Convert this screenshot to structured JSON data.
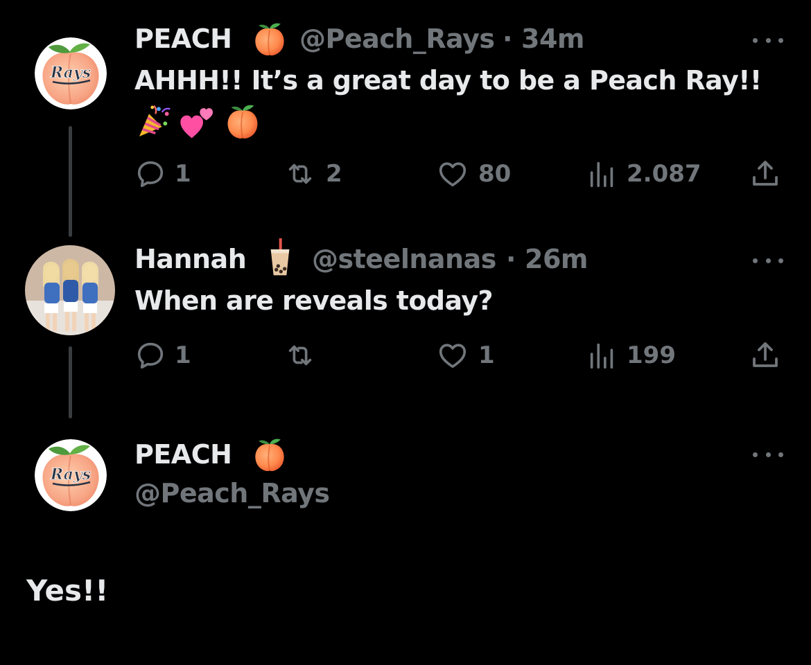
{
  "colors": {
    "background": "#000000",
    "text": "#e7e9ea",
    "muted": "#71767b",
    "thread_line": "#3a3d40"
  },
  "tweet1": {
    "name": "PEACH",
    "name_emoji": "peach-emoji",
    "handle": "@Peach_Rays",
    "separator": "·",
    "time": "34m",
    "text": "AHHH!! It’s a great day to be a Peach Ray!!",
    "text_emojis": [
      "party-popper-emoji",
      "two-hearts-emoji",
      "peach-emoji"
    ],
    "avatar_text": "Rays",
    "replies": "1",
    "retweets": "2",
    "likes": "80",
    "views": "2.087"
  },
  "tweet2": {
    "name": "Hannah",
    "name_emoji": "bubble-tea-emoji",
    "handle": "@steelnanas",
    "separator": "·",
    "time": "26m",
    "text": "When are reveals today?",
    "replies": "1",
    "retweets": "",
    "likes": "1",
    "views": "199"
  },
  "tweet3": {
    "name": "PEACH",
    "name_emoji": "peach-emoji",
    "handle": "@Peach_Rays",
    "avatar_text": "Rays",
    "text": "Yes!!"
  }
}
